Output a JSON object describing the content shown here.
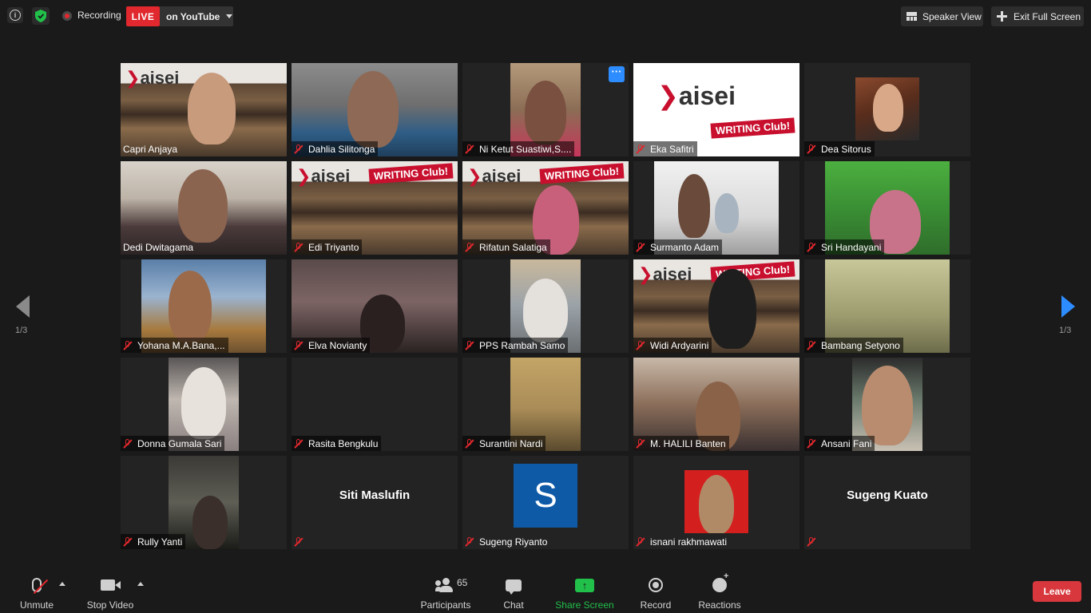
{
  "topbar": {
    "recording_label": "Recording",
    "live_badge": "LIVE",
    "live_platform": "on YouTube",
    "speaker_view": "Speaker View",
    "exit_full_screen": "Exit Full Screen"
  },
  "pager": {
    "left": "1/3",
    "right": "1/3"
  },
  "tiles": [
    {
      "name": "Capri Anjaya"
    },
    {
      "name": "Dahlia Silitonga"
    },
    {
      "name": "Ni Ketut Suastiwi,S...."
    },
    {
      "name": "Eka Safitri"
    },
    {
      "name": "Dea Sitorus"
    },
    {
      "name": "Dedi Dwitagama"
    },
    {
      "name": "Edi Triyanto"
    },
    {
      "name": "Rifatun Salatiga"
    },
    {
      "name": "Surmanto Adam"
    },
    {
      "name": "Sri Handayani"
    },
    {
      "name": "Yohana M.A.Bana,..."
    },
    {
      "name": "Elva Novianty"
    },
    {
      "name": "PPS Rambah Samo"
    },
    {
      "name": "Widi Ardyarini"
    },
    {
      "name": "Bambang Setyono"
    },
    {
      "name": "Donna Gumala Sari"
    },
    {
      "name": "Rasita Bengkulu"
    },
    {
      "name": "Surantini Nardi"
    },
    {
      "name": "M. HALILI Banten"
    },
    {
      "name": "Ansani Fani"
    },
    {
      "name": "Rully Yanti"
    },
    {
      "name": "Siti Maslufin"
    },
    {
      "name": "Sugeng Riyanto",
      "avatar_letter": "S"
    },
    {
      "name": "isnani rakhmawati"
    },
    {
      "name": "Sugeng Kuato"
    }
  ],
  "logo": {
    "brand": "aisei",
    "badge": "WRITING Club!"
  },
  "more_button": "···",
  "toolbar": {
    "unmute": "Unmute",
    "stop_video": "Stop Video",
    "participants": "Participants",
    "participants_count": "65",
    "chat": "Chat",
    "share_screen": "Share Screen",
    "record": "Record",
    "reactions": "Reactions",
    "leave": "Leave"
  },
  "colors": {
    "live_red": "#e0282e",
    "accent_blue": "#2d8cff",
    "share_green": "#21c04a",
    "active_speaker": "#dde36a",
    "leave_red": "#d8383d"
  }
}
